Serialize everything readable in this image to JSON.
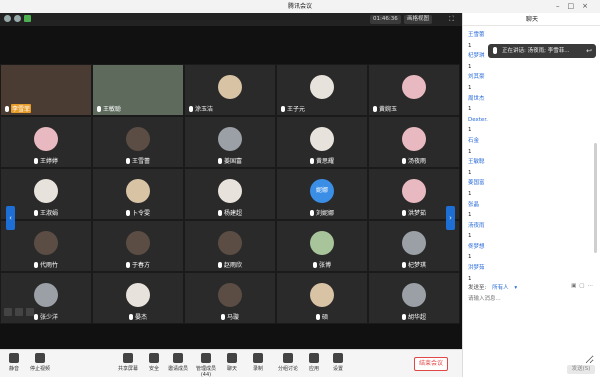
{
  "window": {
    "title": "腾讯会议"
  },
  "header": {
    "timer": "01:46:36",
    "view_label": "画格视图",
    "fullscreen_icon": "expand-icon"
  },
  "grid": {
    "rows": [
      [
        {
          "name": "李雪菲",
          "kind": "video"
        },
        {
          "name": "王敏聪",
          "kind": "video2"
        },
        {
          "name": "涂玉洁",
          "kind": "avatar",
          "color": "tan"
        },
        {
          "name": "王子元",
          "kind": "avatar",
          "color": "light"
        },
        {
          "name": "黄婉玉",
          "kind": "avatar",
          "color": "pink"
        }
      ],
      [
        {
          "name": "王婷婷",
          "kind": "avatar",
          "color": "pink"
        },
        {
          "name": "王雪蕾",
          "kind": "avatar",
          "color": "dark"
        },
        {
          "name": "姜国富",
          "kind": "avatar",
          "color": "gray"
        },
        {
          "name": "黄思耀",
          "kind": "avatar",
          "color": "light"
        },
        {
          "name": "汤夜雨",
          "kind": "avatar",
          "color": "pink"
        }
      ],
      [
        {
          "name": "王淑娟",
          "kind": "avatar",
          "color": "light"
        },
        {
          "name": "卜令雯",
          "kind": "avatar",
          "color": "tan"
        },
        {
          "name": "杨建超",
          "kind": "avatar",
          "color": "light"
        },
        {
          "name": "刘妮娜",
          "kind": "avatar",
          "color": "blue",
          "initials": "妮娜"
        },
        {
          "name": "洪梦茹",
          "kind": "avatar",
          "color": "pink"
        }
      ],
      [
        {
          "name": "代雨竹",
          "kind": "avatar",
          "color": "dark"
        },
        {
          "name": "于春方",
          "kind": "avatar",
          "color": "dark"
        },
        {
          "name": "赵雨欣",
          "kind": "avatar",
          "color": "dark"
        },
        {
          "name": "张博",
          "kind": "avatar",
          "color": "green"
        },
        {
          "name": "杞梦琪",
          "kind": "avatar",
          "color": "gray"
        }
      ],
      [
        {
          "name": "张少洋",
          "kind": "avatar",
          "color": "gray"
        },
        {
          "name": "晏杰",
          "kind": "avatar",
          "color": "light"
        },
        {
          "name": "马璇",
          "kind": "avatar",
          "color": "dark"
        },
        {
          "name": "硕",
          "kind": "avatar",
          "color": "tan"
        },
        {
          "name": "胡华超",
          "kind": "avatar",
          "color": "gray"
        }
      ]
    ]
  },
  "toolbar": {
    "items": [
      "静音",
      "停止视频",
      "共享屏幕",
      "安全",
      "邀请成员",
      "管理成员(44)",
      "聊天",
      "录制",
      "分组讨论",
      "应用",
      "设置"
    ],
    "end_label": "结束会议"
  },
  "chat": {
    "title": "聊天",
    "messages": [
      {
        "from": "王雪蕾",
        "text": "1"
      },
      {
        "from": "杞梦琪",
        "text": "1"
      },
      {
        "from": "刘其豪",
        "text": "1"
      },
      {
        "from": "周世杰",
        "text": "1"
      },
      {
        "from": "Dexter.",
        "text": "1"
      },
      {
        "from": "石金",
        "text": "1"
      },
      {
        "from": "王敏聪",
        "text": "1"
      },
      {
        "from": "姜国富",
        "text": "1"
      },
      {
        "from": "张晶",
        "text": "1"
      },
      {
        "from": "汤夜雨",
        "text": "1"
      },
      {
        "from": "佟梦想",
        "text": "1"
      },
      {
        "from": "洪梦茹",
        "text": "1"
      }
    ],
    "speaking_banner": "正在讲话: 汤夜雨; 李雪菲...",
    "send_to_label": "发送至:",
    "send_to_value": "所有人",
    "input_placeholder": "请输入消息...",
    "send_button": "发送(S)"
  }
}
